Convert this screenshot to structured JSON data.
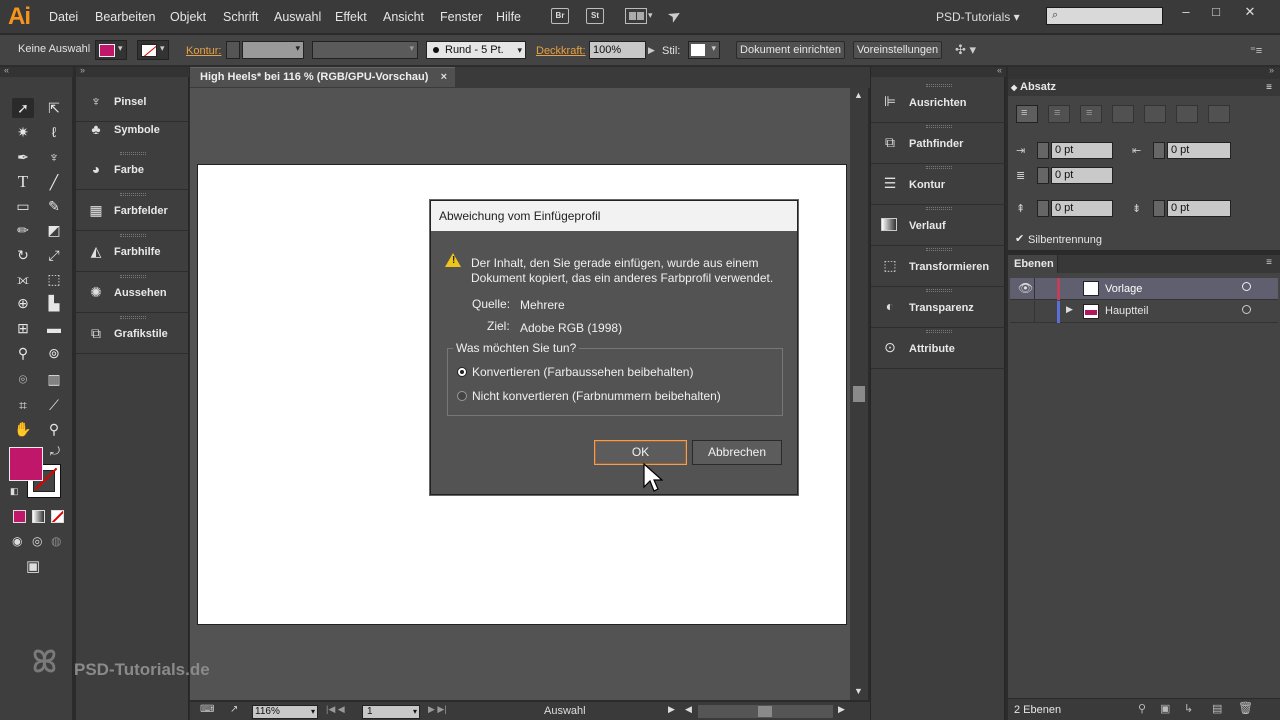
{
  "app": {
    "logo": "Ai"
  },
  "menubar": {
    "items": [
      "Datei",
      "Bearbeiten",
      "Objekt",
      "Schrift",
      "Auswahl",
      "Effekt",
      "Ansicht",
      "Fenster",
      "Hilfe"
    ],
    "bridge_label": "Br",
    "stock_label": "St",
    "workspace": "PSD-Tutorials",
    "window_controls": {
      "minimize": "–",
      "maximize": "□",
      "close": "✕"
    }
  },
  "controlbar": {
    "selection": "Keine Auswahl",
    "kontur_label": "Kontur:",
    "stroke_style": "Rund - 5 Pt.",
    "deckkraft_label": "Deckkraft:",
    "opacity": "100%",
    "stil_label": "Stil:",
    "doc_setup": "Dokument einrichten",
    "preferences": "Voreinstellungen",
    "fill_color": "#c0176a"
  },
  "left_panels": [
    {
      "label": "Pinsel",
      "icon": "brush-icon"
    },
    {
      "label": "Symbole",
      "icon": "symbols-icon"
    },
    {
      "label": "Farbe",
      "icon": "palette-icon"
    },
    {
      "label": "Farbfelder",
      "icon": "swatches-icon"
    },
    {
      "label": "Farbhilfe",
      "icon": "color-guide-icon"
    },
    {
      "label": "Aussehen",
      "icon": "appearance-icon"
    },
    {
      "label": "Grafikstile",
      "icon": "graphic-styles-icon"
    }
  ],
  "document": {
    "tab_title": "High Heels* bei 116 % (RGB/GPU-Vorschau)",
    "tab_close": "×"
  },
  "statusbar": {
    "zoom": "116%",
    "page": "1",
    "tool": "Auswahl"
  },
  "watermark": "PSD-Tutorials.de",
  "dialog": {
    "title": "Abweichung vom Einfügeprofil",
    "message_line1": "Der Inhalt, den Sie gerade einfügen, wurde aus einem",
    "message_line2": "Dokument kopiert, das ein anderes Farbprofil verwendet.",
    "source_label": "Quelle:",
    "source_value": "Mehrere",
    "target_label": "Ziel:",
    "target_value": "Adobe RGB (1998)",
    "question": "Was möchten Sie tun?",
    "option_convert": "Konvertieren (Farbaussehen beibehalten)",
    "option_keep": "Nicht konvertieren (Farbnummern beibehalten)",
    "selected_option": "convert",
    "ok": "OK",
    "cancel": "Abbrechen"
  },
  "right_panels": [
    {
      "label": "Ausrichten",
      "icon": "align-icon"
    },
    {
      "label": "Pathfinder",
      "icon": "pathfinder-icon"
    },
    {
      "label": "Kontur",
      "icon": "stroke-icon"
    },
    {
      "label": "Verlauf",
      "icon": "gradient-icon"
    },
    {
      "label": "Transformieren",
      "icon": "transform-icon"
    },
    {
      "label": "Transparenz",
      "icon": "transparency-icon"
    },
    {
      "label": "Attribute",
      "icon": "attributes-icon"
    }
  ],
  "absatz": {
    "title": "Absatz",
    "indent_left": "0 pt",
    "indent_right": "0 pt",
    "first_line": "0 pt",
    "space_before": "0 pt",
    "space_after": "0 pt",
    "hyphenation": "Silbentrennung",
    "hyphenation_checked": true
  },
  "ebenen": {
    "title": "Ebenen",
    "layers": [
      {
        "name": "Vorlage",
        "color": "#c0405a",
        "selected": true
      },
      {
        "name": "Hauptteil",
        "color": "#5a6fd8",
        "selected": false
      }
    ],
    "count": "2 Ebenen"
  }
}
